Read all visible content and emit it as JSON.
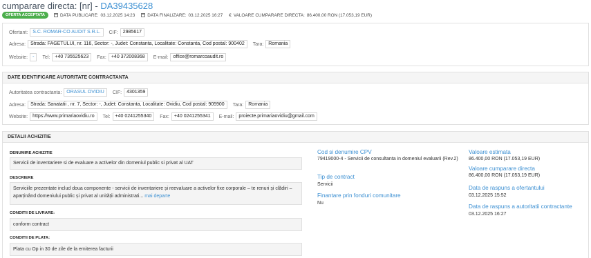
{
  "header": {
    "title_prefix": "cumparare directa: [nr] - ",
    "title_code": "DA39435628",
    "badge": "OFERTA ACCEPTATA",
    "publish_label": "DATA PUBLICARE:",
    "publish_value": "03.12.2025 14:23",
    "final_label": "DATA FINALIZARE:",
    "final_value": "03.12.2025 16:27",
    "value_label": "VALOARE CUMPARARE DIRECTA:",
    "value_value": "86.400,00  RON (17.053,19  EUR)"
  },
  "supplier": {
    "ofertant_label": "Ofertant:",
    "ofertant": "S.C. ROMAR-CO AUDIT S.R.L.",
    "cif_label": "CIF:",
    "cif": "2985617",
    "adresa_label": "Adresa:",
    "adresa": "Strada: FAGETULUI, nr. 116, Sector: -, Judet: Constanta, Localitate: Constanta, Cod postal: 900402",
    "tara_label": "Tara:",
    "tara": "Romania",
    "website_label": "Website:",
    "website": "-",
    "tel_label": "Tel:",
    "tel": "+40 735525623",
    "fax_label": "Fax:",
    "fax": "+40 372008368",
    "email_label": "E-mail:",
    "email": "office@romarcoaudit.ro"
  },
  "authority": {
    "heading": "DATE IDENTIFICARE AUTORITATE CONTRACTANTA",
    "autoritate_label": "Autoritatea contractanta:",
    "autoritate": "ORASUL OVIDIU",
    "cif_label": "CIF:",
    "cif": "4301359",
    "adresa_label": "Adresa:",
    "adresa": "Strada: Sanatatii , nr. 7, Sector: -, Judet: Constanta, Localitate: Ovidiu, Cod postal: 905900",
    "tara_label": "Tara:",
    "tara": "Romania",
    "website_label": "Website:",
    "website": "https://www.primariaovidiu.ro",
    "tel_label": "Tel:",
    "tel": "+40 0241255340",
    "fax_label": "Fax:",
    "fax": "+40 0241255341",
    "email_label": "E-mail:",
    "email": "proiecte.primariaovidiu@gmail.com"
  },
  "details": {
    "heading": "DETALII ACHIZITIE",
    "denumire_label": "DENUMIRE ACHIZITIE",
    "denumire": "Servicii de inventariere si de evaluare a activelor din domeniul public si privat al UAT",
    "descriere_label": "DESCRIERE",
    "descriere": "Serviciile prezentate includ doua componente - servicii de inventariere și reevaluare a activelor fixe corporale – te renuri și clădiri – aparținând domeniului public și privat al unității administrati...",
    "more_label": "mai departe",
    "livrare_label": "CONDITII DE LIVRARE:",
    "livrare": "conform contract",
    "plata_label": "CONDITII DE PLATA:",
    "plata": "Plata cu Op in 30 de zile de la emiterea facturii",
    "cpv_label": "Cod si denumire CPV",
    "cpv": "79419000-4 - Servicii de consultanta in domeniul evaluarii (Rev.2)",
    "tip_label": "Tip de contract",
    "tip": "Servicii",
    "fonduri_label": "Finantare prin fonduri comunitare",
    "fonduri": "Nu",
    "estimata_label": "Valoare estimata",
    "estimata": "86.400,00  RON (17.053,19  EUR)",
    "cumparare_label": "Valoare cumparare directa",
    "cumparare": "86.400,00  RON (17.053,19  EUR)",
    "raspuns_ofertant_label": "Data de raspuns a ofertantului",
    "raspuns_ofertant": "03.12.2025 15:52",
    "raspuns_autoritate_label": "Data de raspuns a autoritatii contractante",
    "raspuns_autoritate": "03.12.2025 16:27"
  }
}
